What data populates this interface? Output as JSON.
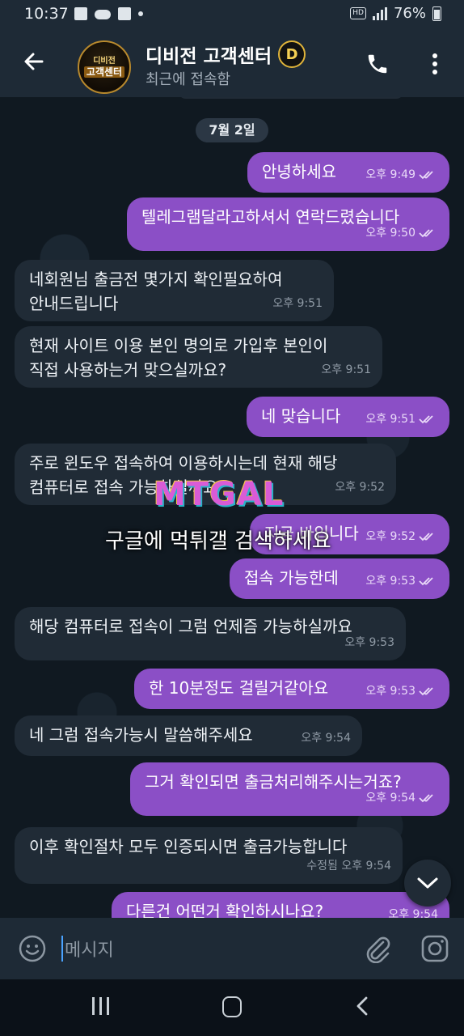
{
  "status_bar": {
    "time": "10:37",
    "battery": "76%"
  },
  "header": {
    "avatar_line1": "디비전",
    "avatar_line2": "고객센터",
    "title": "디비전 고객센터",
    "badge": "D",
    "subtitle": "최근에 접속함"
  },
  "chat": {
    "date": "7월 2일",
    "messages": [
      {
        "dir": "out",
        "text": "안녕하세요",
        "time": "오후 9:49",
        "read": true
      },
      {
        "dir": "out",
        "text": "텔레그램달라고하셔서 연락드렸습니다",
        "time": "오후 9:50",
        "read": true
      },
      {
        "dir": "in",
        "text_l1": "네회원님 출금전 몇가지 확인필요하여",
        "text_l2": "안내드립니다",
        "time": "오후 9:51"
      },
      {
        "dir": "in",
        "text_l1": "현재 사이트 이용 본인 명의로 가입후 본인이",
        "text_l2": "직접 사용하는거 맞으실까요?",
        "time": "오후 9:51"
      },
      {
        "dir": "out",
        "text": "네 맞습니다",
        "time": "오후 9:51",
        "read": true
      },
      {
        "dir": "in",
        "text_l1": "주로 윈도우 접속하여 이용하시는데 현재 해당",
        "text_l2": "컴퓨터로 접속 가능하실까요",
        "time": "오후 9:52"
      },
      {
        "dir": "out",
        "text": "지금 바입니다",
        "time": "오후 9:52",
        "read": true
      },
      {
        "dir": "out",
        "text": "접속 가능한데",
        "time": "오후 9:53",
        "read": true
      },
      {
        "dir": "in",
        "text": "해당 컴퓨터로 접속이 그럼 언제즘 가능하실까요",
        "time": "오후 9:53"
      },
      {
        "dir": "out",
        "text": "한 10분정도 걸릴거같아요",
        "time": "오후 9:53",
        "read": true
      },
      {
        "dir": "in",
        "text": "네 그럼 접속가능시 말씀해주세요",
        "time": "오후 9:54"
      },
      {
        "dir": "out",
        "text": "그거 확인되면 출금처리해주시는거죠?",
        "time": "오후 9:54",
        "read": true
      },
      {
        "dir": "in",
        "text": "이후 확인절차 모두 인증되시면 출금가능합니다",
        "time": "수정됨 오후 9:54"
      },
      {
        "dir": "out",
        "text": "다른건 어떤거 확인하시나요?",
        "time": "오후 9:54",
        "read": true
      }
    ]
  },
  "watermark": {
    "logo": "MTGAL",
    "text": "구글에 먹튀갤 검색하세요"
  },
  "input": {
    "placeholder": "메시지"
  },
  "colors": {
    "outgoing": "#8b4fc6",
    "incoming": "#202b36",
    "header": "#1e2a36",
    "background": "#101921"
  }
}
